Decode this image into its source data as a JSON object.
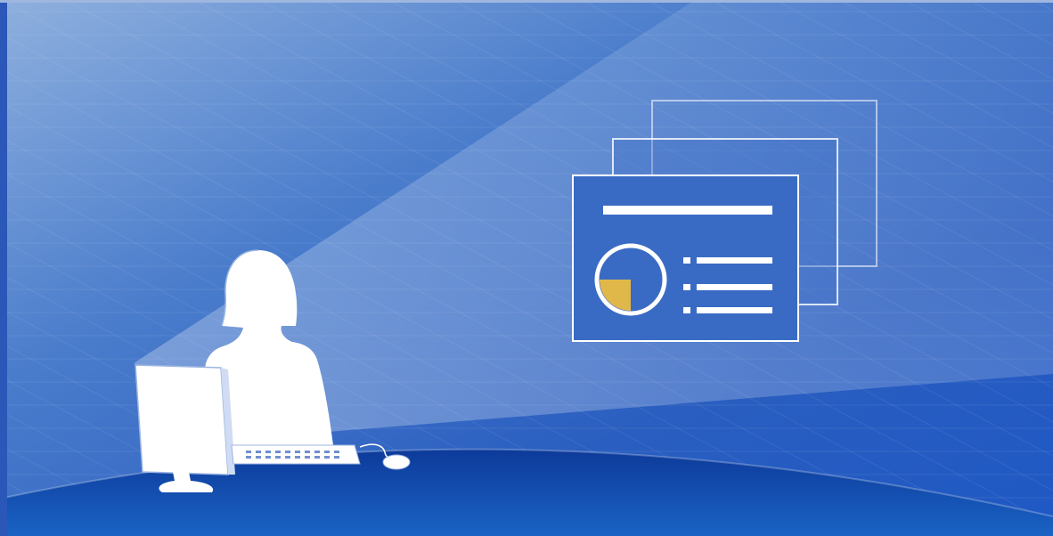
{
  "scene": {
    "background_top": "#3f78c9",
    "background_mid": "#2c5fbf",
    "background_bottom": "#0a2f8c",
    "accent_gold": "#e0b84a",
    "figure_color": "#ffffff",
    "icons": {
      "person": "user-at-computer-icon",
      "monitor": "monitor-icon",
      "keyboard": "keyboard-icon",
      "mouse": "mouse-icon",
      "slides": "presentation-slides-icon",
      "chart": "pie-chart-icon"
    },
    "chart_slice_fraction": 0.25
  }
}
